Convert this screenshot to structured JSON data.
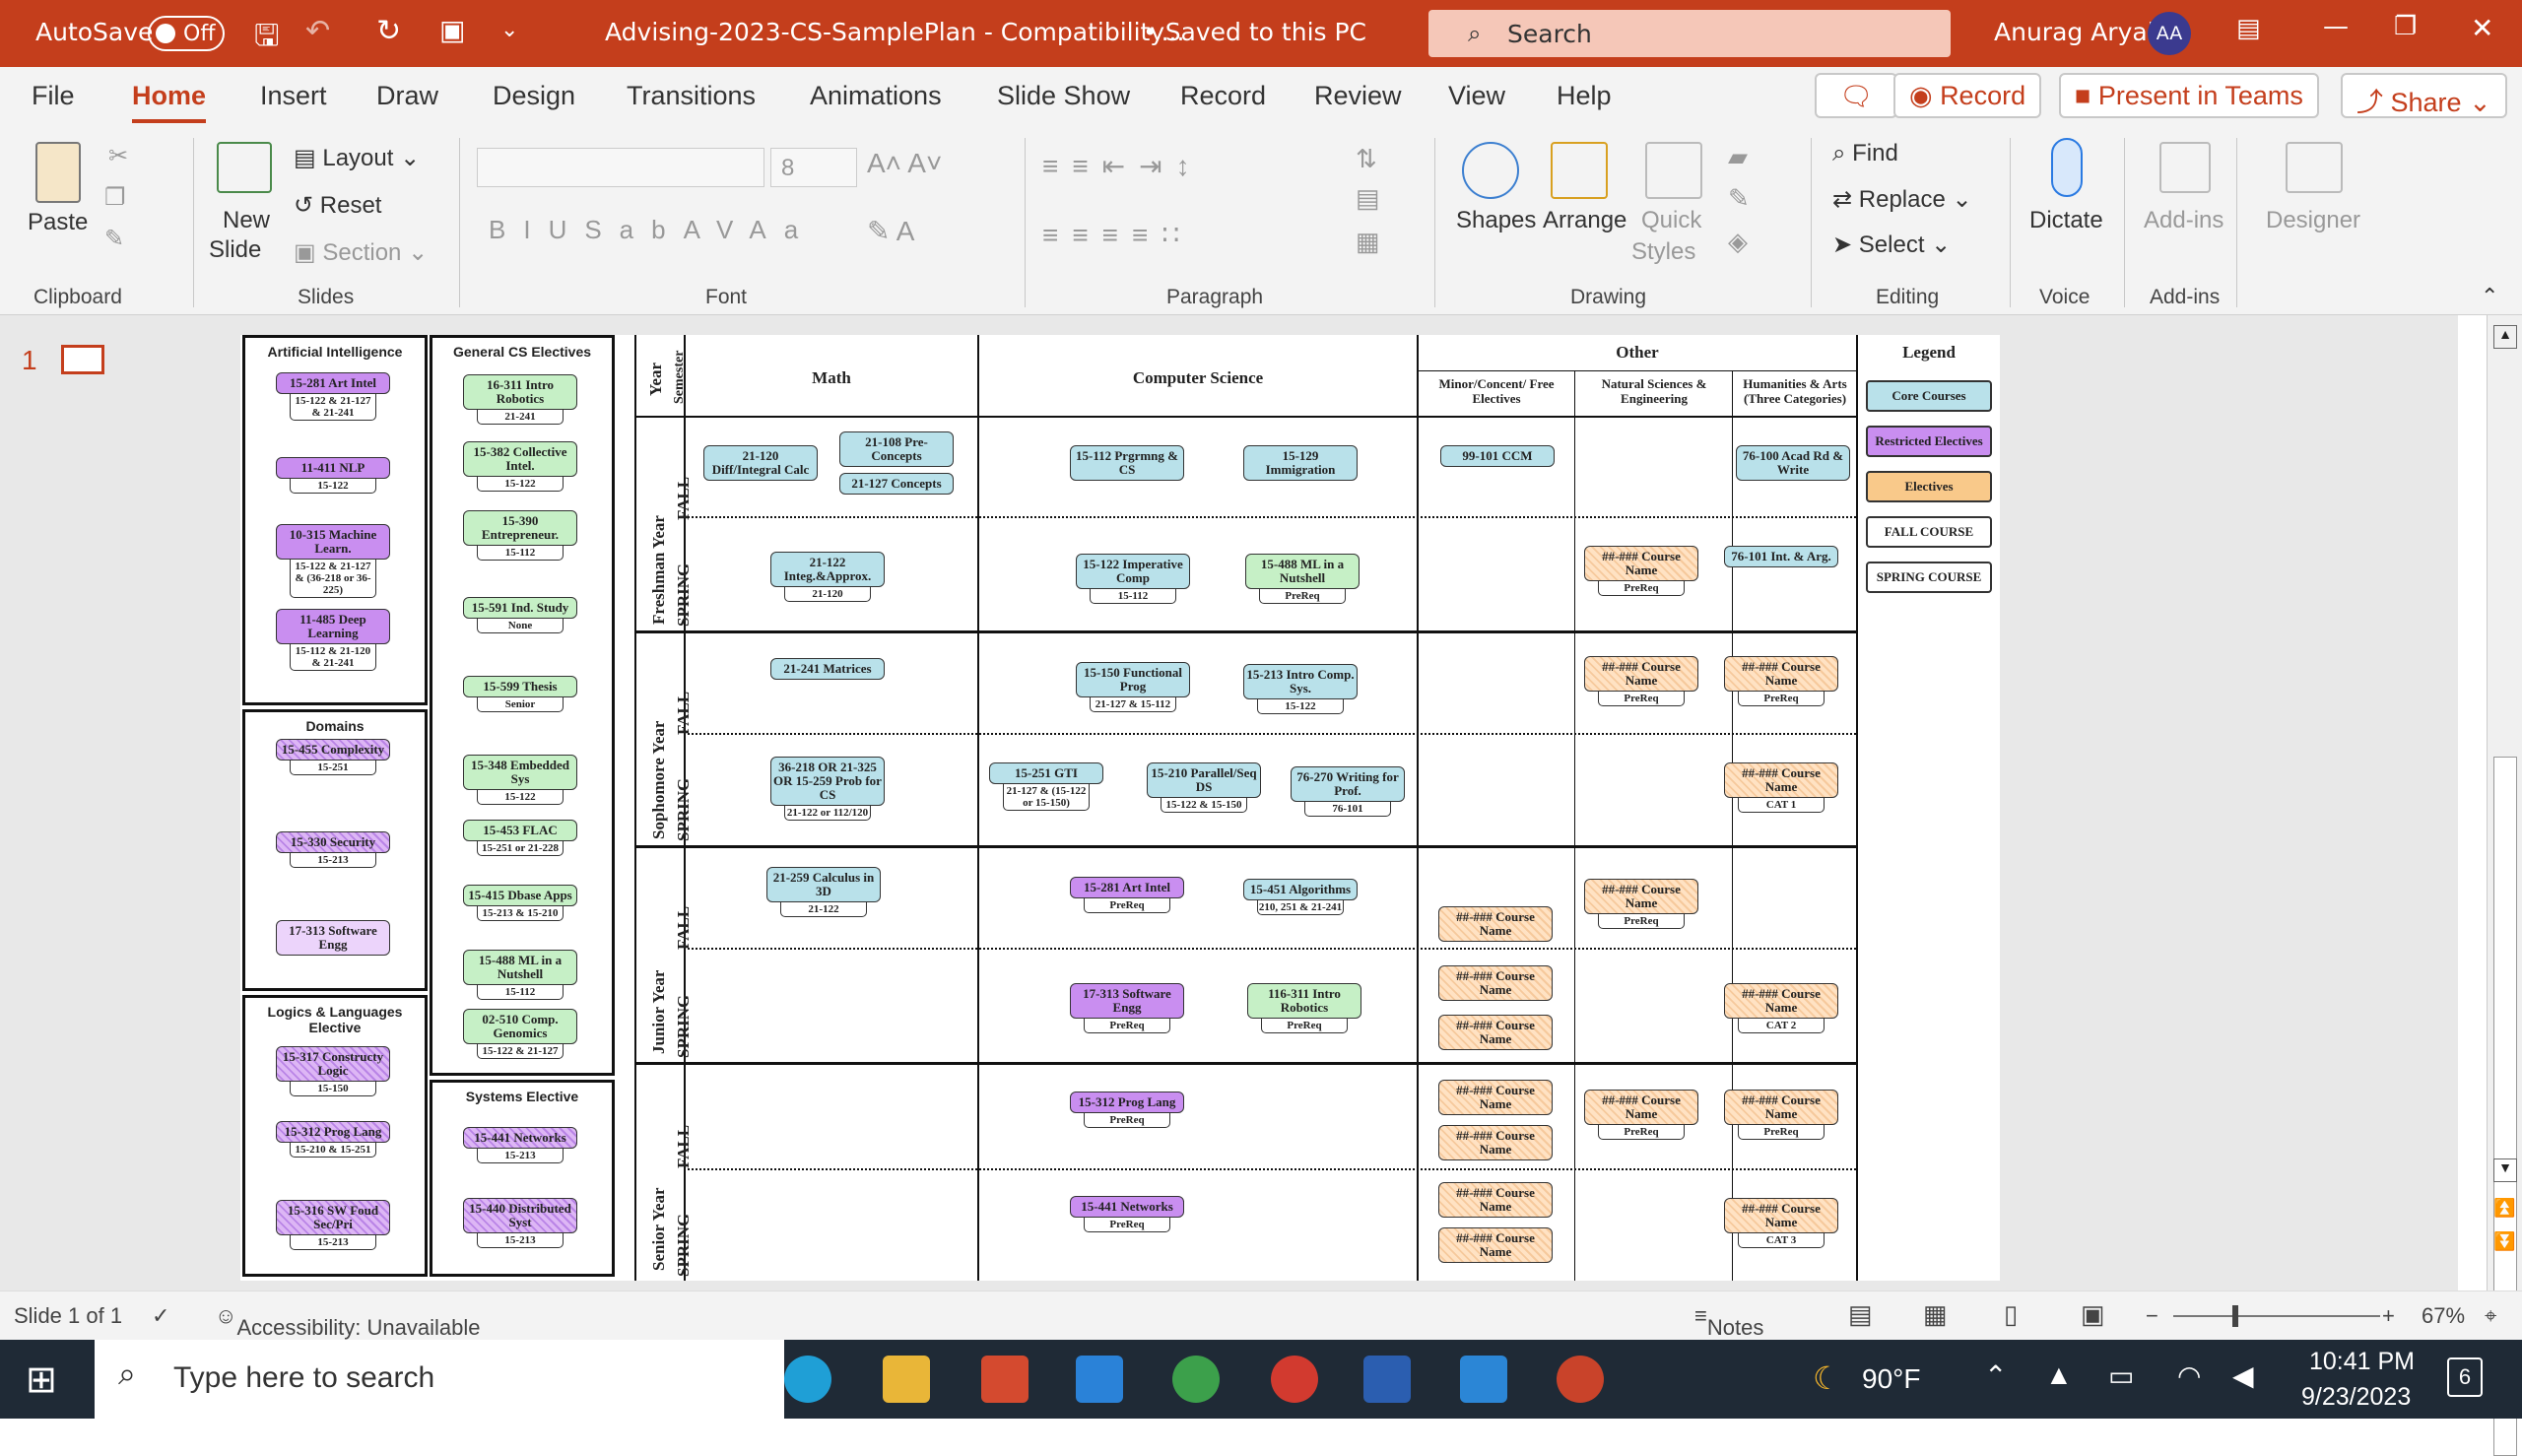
{
  "titlebar": {
    "autosave": "AutoSave",
    "toggle": "Off",
    "doc": "Advising-2023-CS-SamplePlan  -  Compatibility...",
    "saved": "• Saved to this PC",
    "search": "Search",
    "user": "Anurag Aryal",
    "initials": "AA"
  },
  "tabs": [
    "File",
    "Home",
    "Insert",
    "Draw",
    "Design",
    "Transitions",
    "Animations",
    "Slide Show",
    "Record",
    "Review",
    "View",
    "Help"
  ],
  "tabbtns": {
    "record": "Record",
    "present": "Present in Teams",
    "share": "Share"
  },
  "ribbon": {
    "paste": "Paste",
    "new": "New",
    "slide": "Slide",
    "layout": "Layout",
    "reset": "Reset",
    "section": "Section",
    "fontsize": "8",
    "shapes": "Shapes",
    "arrange": "Arrange",
    "quick": "Quick",
    "styles": "Styles",
    "find": "Find",
    "replace": "Replace",
    "select": "Select",
    "dictate": "Dictate",
    "addins": "Add-ins",
    "designer": "Designer",
    "groups": [
      "Clipboard",
      "Slides",
      "Font",
      "Paragraph",
      "Drawing",
      "Editing",
      "Voice",
      "Add-ins"
    ]
  },
  "slidenum": "1",
  "status": {
    "slide": "Slide 1 of 1",
    "access": "Accessibility: Unavailable",
    "notes": "Notes",
    "zoom": "67%"
  },
  "taskbar": {
    "search": "Type here to search",
    "temp": "90°F",
    "time": "10:41 PM",
    "date": "9/23/2023",
    "notif": "6"
  },
  "slide": {
    "panels": {
      "ai": "Artificial Intelligence",
      "gen": "General CS Electives",
      "dom": "Domains",
      "logic": "Logics & Languages Elective",
      "sys": "Systems Elective"
    },
    "headers": {
      "year": "Year",
      "sem": "Semester",
      "math": "Math",
      "cs": "Computer Science",
      "other": "Other",
      "minor": "Minor/Concent/ Free Electives",
      "nat": "Natural Sciences & Engineering",
      "hum": "Humanities & Arts (Three Categories)",
      "legend": "Legend"
    },
    "years": [
      "Freshman Year",
      "Sophomore Year",
      "Junior Year",
      "Senior Year"
    ],
    "sems": [
      "FALL",
      "SPRING"
    ],
    "legend": [
      "Core Courses",
      "Restricted Electives",
      "Electives",
      "FALL COURSE",
      "SPRING COURSE"
    ]
  },
  "cards": [
    {
      "t": "15-281 Art Intel",
      "b": "15-122 & 21-127 & 21-241"
    },
    {
      "t": "11-411 NLP",
      "b": "15-122"
    },
    {
      "t": "10-315 Machine Learn.",
      "b": "15-122 & 21-127 & (36-218 or 36-225)"
    },
    {
      "t": "11-485 Deep Learning",
      "b": "15-112 & 21-120 & 21-241"
    },
    {
      "t": "15-455 Complexity",
      "b": "15-251"
    },
    {
      "t": "15-330 Security",
      "b": "15-213"
    },
    {
      "t": "17-313 Software Engg",
      "b": ""
    },
    {
      "t": "15-317 Constructy Logic",
      "b": "15-150"
    },
    {
      "t": "15-312 Prog Lang",
      "b": "15-210 & 15-251"
    },
    {
      "t": "15-316 SW Foud Sec/Pri",
      "b": "15-213"
    },
    {
      "t": "16-311 Intro Robotics",
      "b": "21-241"
    },
    {
      "t": "15-382 Collective Intel.",
      "b": "15-122"
    },
    {
      "t": "15-390 Entrepreneur.",
      "b": "15-112"
    },
    {
      "t": "15-591 Ind. Study",
      "b": "None"
    },
    {
      "t": "15-599 Thesis",
      "b": "Senior"
    },
    {
      "t": "15-348 Embedded Sys",
      "b": "15-122"
    },
    {
      "t": "15-453 FLAC",
      "b": "15-251 or 21-228"
    },
    {
      "t": "15-415 Dbase Apps",
      "b": "15-213 & 15-210"
    },
    {
      "t": "15-488 ML in a Nutshell",
      "b": "15-112"
    },
    {
      "t": "02-510 Comp. Genomics",
      "b": "15-122 & 21-127"
    },
    {
      "t": "15-441 Networks",
      "b": "15-213"
    },
    {
      "t": "15-440 Distributed Syst",
      "b": "15-213"
    },
    {
      "t": "21-120 Diff/Integral Calc",
      "b": ""
    },
    {
      "t": "21-108 Pre-Concepts",
      "b": ""
    },
    {
      "t": "21-127 Concepts",
      "b": ""
    },
    {
      "t": "15-112 Prgrmng & CS",
      "b": ""
    },
    {
      "t": "15-129 Immigration",
      "b": ""
    },
    {
      "t": "99-101 CCM",
      "b": ""
    },
    {
      "t": "76-100 Acad Rd & Write",
      "b": ""
    },
    {
      "t": "21-122 Integ.&Approx.",
      "b": "21-120"
    },
    {
      "t": "15-122 Imperative Comp",
      "b": "15-112"
    },
    {
      "t": "15-488 ML in a Nutshell",
      "b": "PreReq"
    },
    {
      "t": "##-### Course Name",
      "b": "PreReq"
    },
    {
      "t": "76-101 Int. & Arg.",
      "b": ""
    },
    {
      "t": "21-241 Matrices",
      "b": ""
    },
    {
      "t": "15-150 Functional Prog",
      "b": "21-127 & 15-112"
    },
    {
      "t": "15-213 Intro Comp. Sys.",
      "b": "15-122"
    },
    {
      "t": "##-### Course Name",
      "b": "PreReq"
    },
    {
      "t": "##-### Course Name",
      "b": "PreReq"
    },
    {
      "t": "36-218 OR 21-325 OR 15-259 Prob for CS",
      "b": "21-122 or 112/120"
    },
    {
      "t": "15-251 GTI",
      "b": "21-127 & (15-122 or 15-150)"
    },
    {
      "t": "15-210 Parallel/Seq DS",
      "b": "15-122 & 15-150"
    },
    {
      "t": "76-270 Writing for Prof.",
      "b": "76-101"
    },
    {
      "t": "##-### Course Name",
      "b": "CAT 1"
    },
    {
      "t": "21-259 Calculus in 3D",
      "b": "21-122"
    },
    {
      "t": "15-281 Art Intel",
      "b": "PreReq"
    },
    {
      "t": "15-451 Algorithms",
      "b": "210, 251 & 21-241"
    },
    {
      "t": "##-### Course Name",
      "b": ""
    },
    {
      "t": "##-### Course Name",
      "b": "PreReq"
    },
    {
      "t": "17-313 Software Engg",
      "b": "PreReq"
    },
    {
      "t": "116-311 Intro Robotics",
      "b": "PreReq"
    },
    {
      "t": "##-### Course Name",
      "b": ""
    },
    {
      "t": "##-### Course Name",
      "b": ""
    },
    {
      "t": "##-### Course Name",
      "b": "CAT 2"
    },
    {
      "t": "15-312 Prog Lang",
      "b": "PreReq"
    },
    {
      "t": "##-### Course Name",
      "b": ""
    },
    {
      "t": "##-### Course Name",
      "b": ""
    },
    {
      "t": "##-### Course Name",
      "b": "PreReq"
    },
    {
      "t": "##-### Course Name",
      "b": "PreReq"
    },
    {
      "t": "15-441 Networks",
      "b": "PreReq"
    },
    {
      "t": "##-### Course Name",
      "b": ""
    },
    {
      "t": "##-### Course Name",
      "b": ""
    },
    {
      "t": "##-### Course Name",
      "b": "CAT 3"
    }
  ]
}
